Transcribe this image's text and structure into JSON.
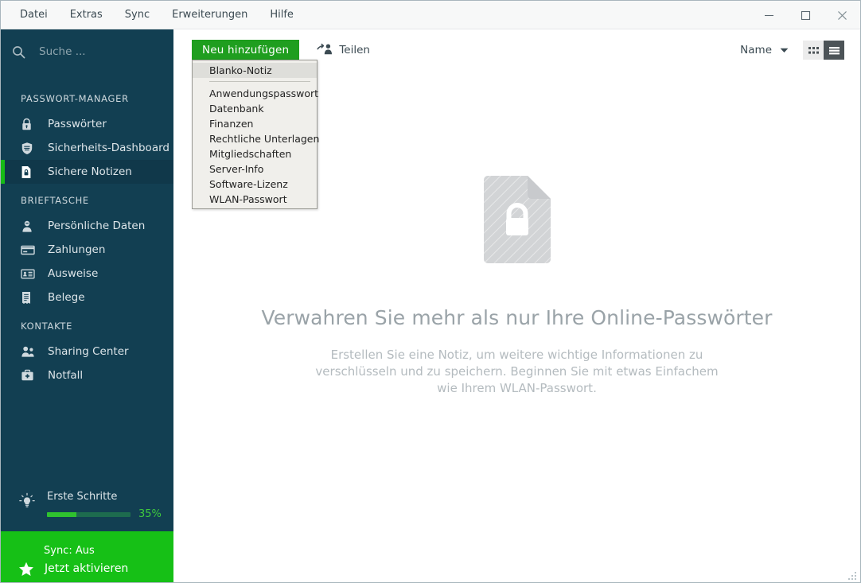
{
  "window": {
    "menu": [
      {
        "label": "Datei",
        "name": "menu-datei"
      },
      {
        "label": "Extras",
        "name": "menu-extras"
      },
      {
        "label": "Sync",
        "name": "menu-sync"
      },
      {
        "label": "Erweiterungen",
        "name": "menu-erweiterungen"
      },
      {
        "label": "Hilfe",
        "name": "menu-hilfe"
      }
    ],
    "controls": {
      "minimize": "minimize-button",
      "maximize": "maximize-button",
      "close": "close-button"
    }
  },
  "sidebar": {
    "search": {
      "placeholder": "Suche ...",
      "value": ""
    },
    "sections": [
      {
        "title": "PASSWORT-MANAGER",
        "items": [
          {
            "label": "Passwörter",
            "icon": "lock-icon",
            "active": false
          },
          {
            "label": "Sicherheits-Dashboard",
            "icon": "shield-icon",
            "active": false
          },
          {
            "label": "Sichere Notizen",
            "icon": "secure-note-icon",
            "active": true
          }
        ]
      },
      {
        "title": "BRIEFTASCHE",
        "items": [
          {
            "label": "Persönliche Daten",
            "icon": "person-icon",
            "active": false
          },
          {
            "label": "Zahlungen",
            "icon": "credit-card-icon",
            "active": false
          },
          {
            "label": "Ausweise",
            "icon": "id-card-icon",
            "active": false
          },
          {
            "label": "Belege",
            "icon": "receipt-icon",
            "active": false
          }
        ]
      },
      {
        "title": "KONTAKTE",
        "items": [
          {
            "label": "Sharing Center",
            "icon": "people-icon",
            "active": false
          },
          {
            "label": "Notfall",
            "icon": "first-aid-kit-icon",
            "active": false
          }
        ]
      }
    ],
    "getting_started": {
      "label": "Erste Schritte",
      "percent_label": "35%",
      "percent_value": 35,
      "icon": "lightbulb-icon"
    },
    "sync": {
      "status": "Sync: Aus",
      "action": "Jetzt aktivieren",
      "icon": "star-icon"
    }
  },
  "toolbar": {
    "add_label": "Neu hinzufügen",
    "share_label": "Teilen",
    "share_icon": "share-person-icon",
    "sort_label": "Name",
    "sort_caret_icon": "chevron-down-icon",
    "view_grid_icon": "grid-view-icon",
    "view_list_icon": "list-view-icon",
    "active_view": "list"
  },
  "dropdown": {
    "open": true,
    "items": [
      {
        "label": "Blanko-Notiz",
        "highlight": true,
        "separator_after": true
      },
      {
        "label": "Anwendungspasswort",
        "highlight": false,
        "separator_after": false
      },
      {
        "label": "Datenbank",
        "highlight": false,
        "separator_after": false
      },
      {
        "label": "Finanzen",
        "highlight": false,
        "separator_after": false
      },
      {
        "label": "Rechtliche Unterlagen",
        "highlight": false,
        "separator_after": false
      },
      {
        "label": "Mitgliedschaften",
        "highlight": false,
        "separator_after": false
      },
      {
        "label": "Server-Info",
        "highlight": false,
        "separator_after": false
      },
      {
        "label": "Software-Lizenz",
        "highlight": false,
        "separator_after": false
      },
      {
        "label": "WLAN-Passwort",
        "highlight": false,
        "separator_after": false
      }
    ]
  },
  "empty_state": {
    "icon": "secure-note-large-icon",
    "title": "Verwahren Sie mehr als nur Ihre Online-Passwörter",
    "subtitle": "Erstellen Sie eine Notiz, um weitere wichtige Informationen zu verschlüsseln und zu speichern. Beginnen Sie mit etwas Einfachem wie Ihrem WLAN-Passwort."
  },
  "colors": {
    "sidebar_bg": "#123f52",
    "sidebar_active_bg": "#10384a",
    "accent_green": "#16bb16",
    "button_green": "#1f9e1f",
    "sync_green": "#16c016",
    "text_muted": "#9aa3a8"
  }
}
